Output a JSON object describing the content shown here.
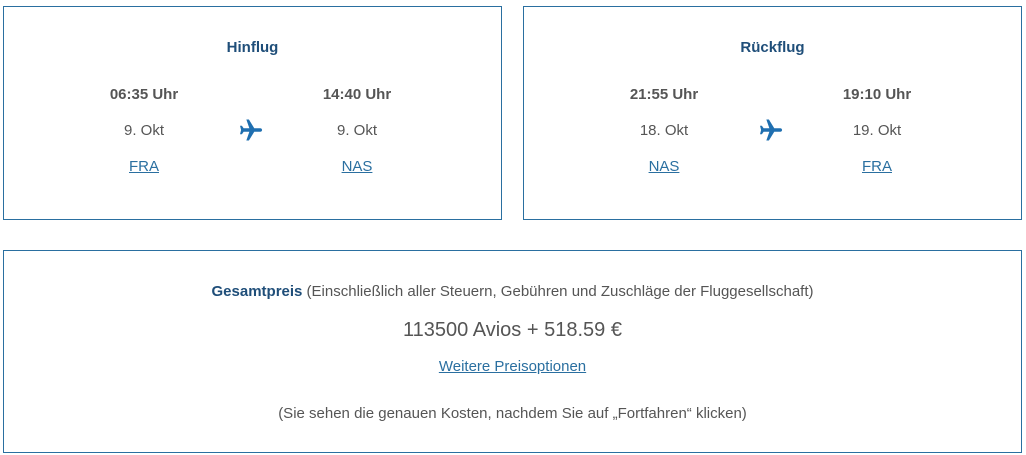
{
  "outbound": {
    "title": "Hinflug",
    "departure": {
      "time": "06:35 Uhr",
      "date": "9. Okt",
      "airport": "FRA"
    },
    "arrival": {
      "time": "14:40 Uhr",
      "date": "9. Okt",
      "airport": "NAS"
    },
    "icon": "airplane-icon"
  },
  "return": {
    "title": "Rückflug",
    "departure": {
      "time": "21:55 Uhr",
      "date": "18. Okt",
      "airport": "NAS"
    },
    "arrival": {
      "time": "19:10 Uhr",
      "date": "19. Okt",
      "airport": "FRA"
    },
    "icon": "airplane-icon"
  },
  "price": {
    "label": "Gesamtpreis",
    "label_note": " (Einschließlich aller Steuern, Gebühren und Zuschläge der Fluggesellschaft)",
    "amount": "113500 Avios + 518.59 €",
    "options_link": "Weitere Preisoptionen",
    "note": "(Sie sehen die genauen Kosten, nachdem Sie auf „Fortfahren“ klicken)"
  },
  "colors": {
    "border": "#2a6fa0",
    "heading": "#1f4e79",
    "link": "#2a6fa0",
    "text": "#555555",
    "icon": "#1f6fb0"
  }
}
